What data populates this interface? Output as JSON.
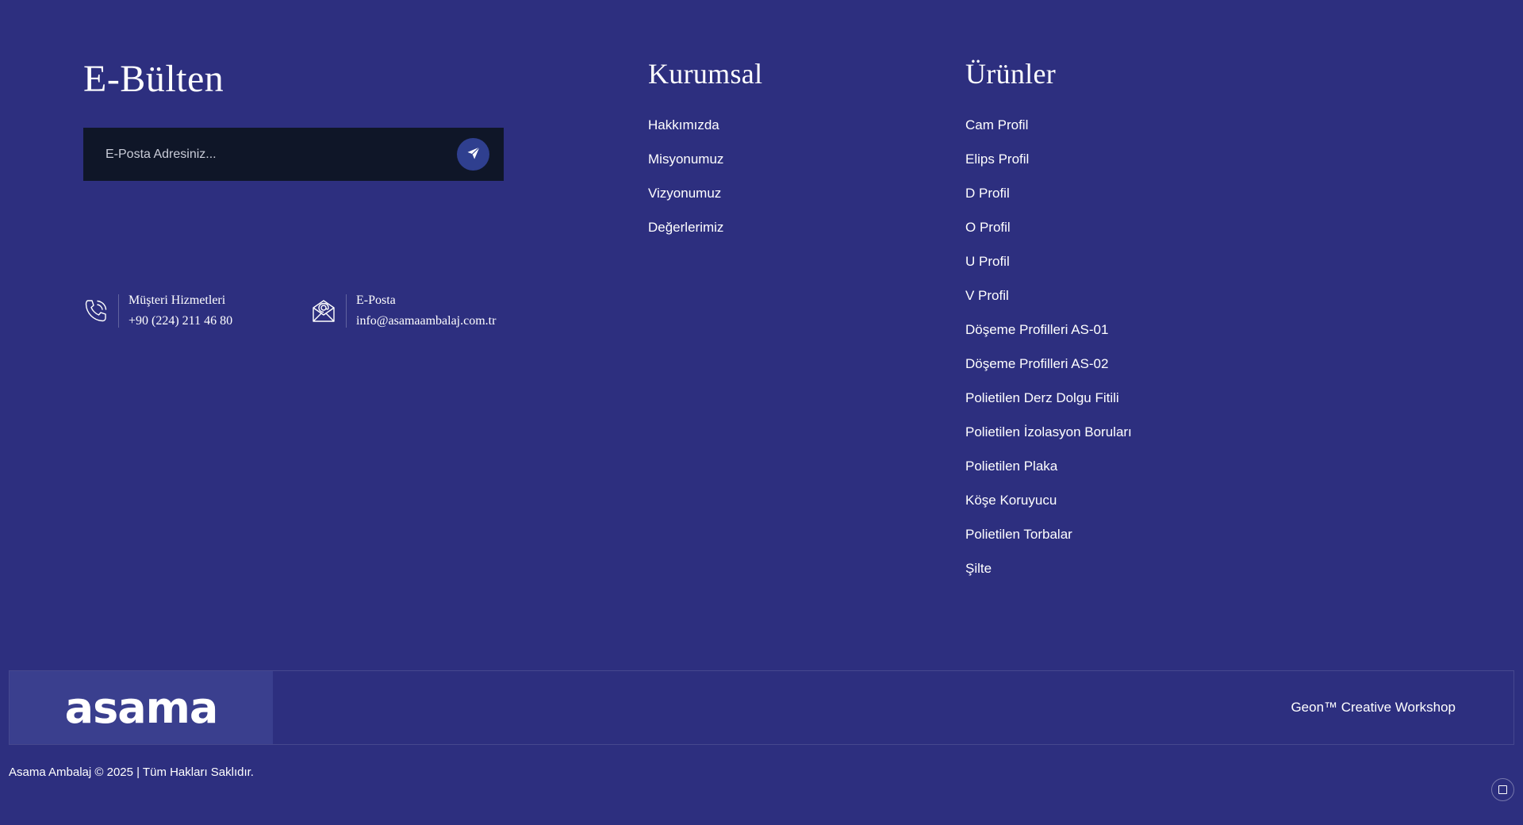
{
  "newsletter": {
    "title": "E-Bülten",
    "placeholder": "E-Posta Adresiniz...",
    "send_icon": "paper-plane-icon"
  },
  "contacts": [
    {
      "icon": "phone-icon",
      "label": "Müşteri Hizmetleri",
      "value": "+90 (224) 211 46 80"
    },
    {
      "icon": "envelope-at-icon",
      "label": "E-Posta",
      "value": "info@asamaambalaj.com.tr"
    }
  ],
  "kurumsal": {
    "title": "Kurumsal",
    "links": [
      "Hakkımızda",
      "Misyonumuz",
      "Vizyonumuz",
      "Değerlerimiz"
    ]
  },
  "urunler": {
    "title": "Ürünler",
    "links": [
      "Cam Profil",
      "Elips Profil",
      "D Profil",
      "O Profil",
      "U Profil",
      "V Profil",
      "Döşeme Profilleri AS-01",
      "Döşeme Profilleri AS-02",
      "Polietilen Derz Dolgu Fitili",
      "Polietilen İzolasyon Boruları",
      "Polietilen Plaka",
      "Köşe Koruyucu",
      "Polietilen Torbalar",
      "Şilte"
    ]
  },
  "bottom_bar": {
    "logo": "asama",
    "credit": "Geon™ Creative Workshop"
  },
  "copyright": "Asama Ambalaj © 2025 | Tüm Hakları Saklıdır.",
  "colors": {
    "background": "#2d2f7f",
    "input_background": "#0f1628",
    "send_button": "#2f3f8f",
    "logo_box": "#3a3f8e"
  }
}
